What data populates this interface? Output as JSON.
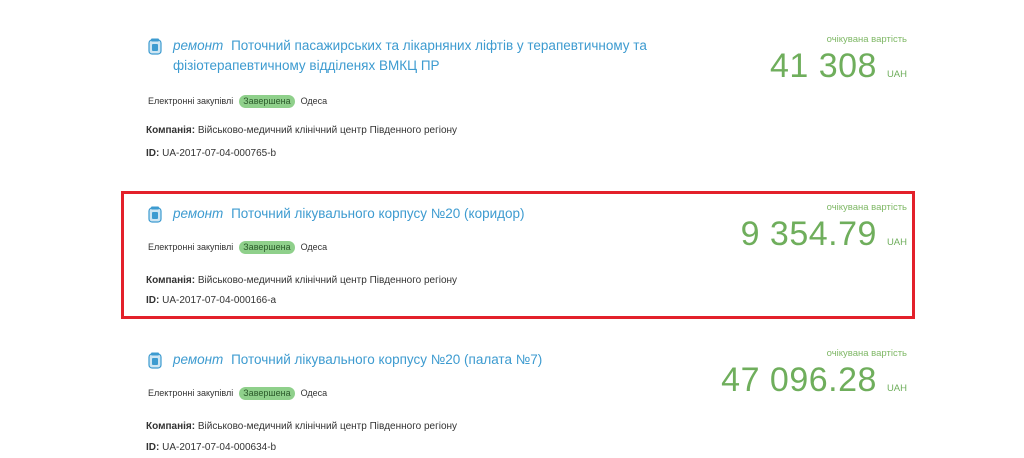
{
  "tenders": [
    {
      "category": "ремонт",
      "title": "Поточний пасажирських та лікарняних ліфтів у терапевтичному та фізіотерапевтичному відділенях ВМКЦ ПР",
      "procurement_type": "Електронні закупівлі",
      "status": "Завершена",
      "city": "Одеса",
      "company_label": "Компанія:",
      "company": "Військово-медичний клінічний центр Південного регіону",
      "id_label": "ID:",
      "id": "UA-2017-07-04-000765-b",
      "price_label": "очікувана вартість",
      "price": "41 308",
      "currency": "UAH",
      "highlighted": false
    },
    {
      "category": "ремонт",
      "title": "Поточний лікувального корпусу №20 (коридор)",
      "procurement_type": "Електронні закупівлі",
      "status": "Завершена",
      "city": "Одеса",
      "company_label": "Компанія:",
      "company": "Військово-медичний клінічний центр Південного регіону",
      "id_label": "ID:",
      "id": "UA-2017-07-04-000166-a",
      "price_label": "очікувана вартість",
      "price": "9 354.79",
      "currency": "UAH",
      "highlighted": true
    },
    {
      "category": "ремонт",
      "title": "Поточний лікувального корпусу №20 (палата №7)",
      "procurement_type": "Електронні закупівлі",
      "status": "Завершена",
      "city": "Одеса",
      "company_label": "Компанія:",
      "company": "Військово-медичний клінічний центр Південного регіону",
      "id_label": "ID:",
      "id": "UA-2017-07-04-000634-b",
      "price_label": "очікувана вартість",
      "price": "47 096.28",
      "currency": "UAH",
      "highlighted": false
    }
  ],
  "colors": {
    "link": "#3d9bd0",
    "price": "#6fae5c",
    "status_badge": "#8fd08b",
    "highlight_border": "#e3202a"
  },
  "icons": {
    "category_icon": "jar-icon"
  }
}
